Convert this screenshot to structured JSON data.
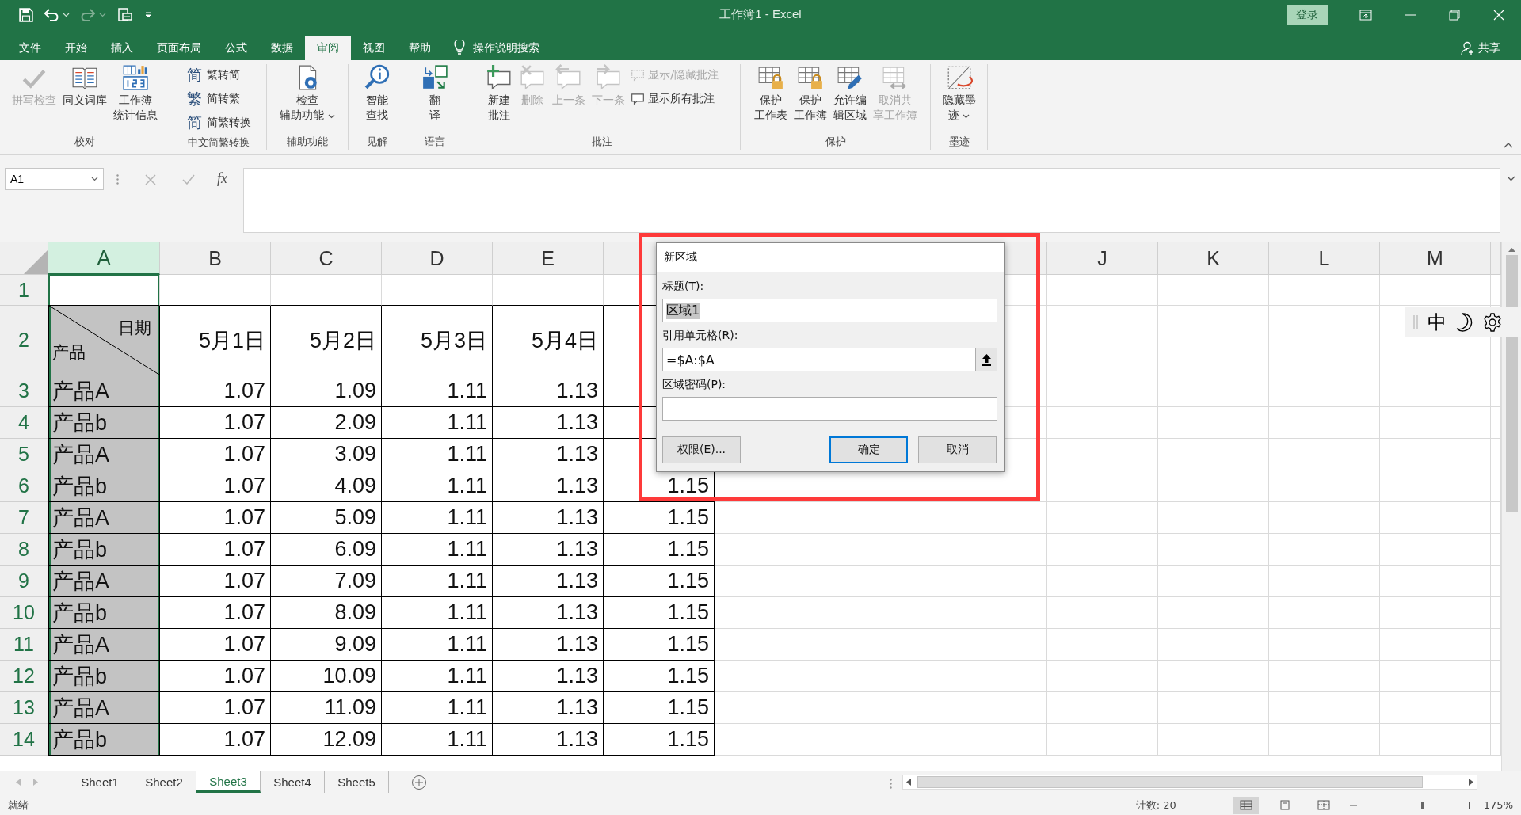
{
  "title_bar": {
    "title": "工作簿1 - Excel",
    "sign_in": "登录"
  },
  "ribbon_tabs": [
    {
      "label": "文件",
      "selected": false
    },
    {
      "label": "开始",
      "selected": false
    },
    {
      "label": "插入",
      "selected": false
    },
    {
      "label": "页面布局",
      "selected": false
    },
    {
      "label": "公式",
      "selected": false
    },
    {
      "label": "数据",
      "selected": false
    },
    {
      "label": "审阅",
      "selected": true
    },
    {
      "label": "视图",
      "selected": false
    },
    {
      "label": "帮助",
      "selected": false
    }
  ],
  "tell_me": "操作说明搜索",
  "share": "共享",
  "ribbon": {
    "groups": [
      {
        "label": "校对",
        "items": [
          {
            "kind": "large",
            "lines": [
              "拼写检查"
            ],
            "disabled": true,
            "dropdown": false
          },
          {
            "kind": "large",
            "lines": [
              "同义词库"
            ],
            "disabled": false,
            "dropdown": false
          },
          {
            "kind": "large",
            "lines": [
              "工作簿",
              "统计信息"
            ],
            "disabled": false,
            "dropdown": false
          }
        ]
      },
      {
        "label": "中文简繁转换",
        "items": [
          {
            "kind": "small",
            "glyph": "简",
            "label": "繁转简",
            "disabled": false,
            "dropdown": false
          },
          {
            "kind": "small",
            "glyph": "繁",
            "label": "简转繁",
            "disabled": false,
            "dropdown": false
          },
          {
            "kind": "small",
            "glyph": "简",
            "label": "简繁转换",
            "disabled": false,
            "dropdown": false
          }
        ]
      },
      {
        "label": "辅助功能",
        "items": [
          {
            "kind": "large",
            "lines": [
              "检查",
              "辅助功能"
            ],
            "disabled": false,
            "dropdown": true
          }
        ]
      },
      {
        "label": "见解",
        "items": [
          {
            "kind": "large",
            "lines": [
              "智能",
              "查找"
            ],
            "disabled": false,
            "dropdown": false
          }
        ]
      },
      {
        "label": "语言",
        "items": [
          {
            "kind": "large",
            "lines": [
              "翻",
              "译"
            ],
            "disabled": false,
            "dropdown": false
          }
        ]
      },
      {
        "label": "批注",
        "items": [
          {
            "kind": "large",
            "lines": [
              "新建",
              "批注"
            ],
            "disabled": false,
            "dropdown": false
          },
          {
            "kind": "large",
            "lines": [
              "删除"
            ],
            "disabled": true,
            "dropdown": false
          },
          {
            "kind": "large",
            "lines": [
              "上一条"
            ],
            "disabled": true,
            "dropdown": false
          },
          {
            "kind": "large",
            "lines": [
              "下一条"
            ],
            "disabled": true,
            "dropdown": false
          },
          {
            "kind": "small",
            "label": "显示/隐藏批注",
            "disabled": true,
            "dropdown": false
          },
          {
            "kind": "small",
            "label": "显示所有批注",
            "disabled": false,
            "dropdown": false
          }
        ]
      },
      {
        "label": "保护",
        "items": [
          {
            "kind": "large",
            "lines": [
              "保护",
              "工作表"
            ],
            "disabled": false,
            "dropdown": false
          },
          {
            "kind": "large",
            "lines": [
              "保护",
              "工作簿"
            ],
            "disabled": false,
            "dropdown": false
          },
          {
            "kind": "large",
            "lines": [
              "允许编",
              "辑区域"
            ],
            "disabled": false,
            "dropdown": false
          },
          {
            "kind": "large",
            "lines": [
              "取消共",
              "享工作簿"
            ],
            "disabled": true,
            "dropdown": false
          }
        ]
      },
      {
        "label": "墨迹",
        "items": [
          {
            "kind": "large",
            "lines": [
              "隐藏墨",
              "迹"
            ],
            "disabled": false,
            "dropdown": true
          }
        ]
      }
    ]
  },
  "formula_bar": {
    "name_box": "A1",
    "function_label": "fx"
  },
  "sheet": {
    "columns": [
      {
        "label": "A",
        "selected": true
      },
      {
        "label": "B",
        "selected": false
      },
      {
        "label": "C",
        "selected": false
      },
      {
        "label": "D",
        "selected": false
      },
      {
        "label": "E",
        "selected": false
      }
    ],
    "right_columns": [
      {
        "label": "J",
        "selected": false
      },
      {
        "label": "K",
        "selected": false
      },
      {
        "label": "L",
        "selected": false
      },
      {
        "label": "M",
        "selected": false
      }
    ],
    "rows": [
      {
        "number": "1",
        "kind": "blank",
        "selected": true
      },
      {
        "number": "2",
        "kind": "header",
        "selected": true,
        "corner": {
          "top": "日期",
          "bottom": "产品"
        },
        "cells": [
          "5月1日",
          "5月2日",
          "5月3日",
          "5月4日"
        ]
      },
      {
        "number": "3",
        "kind": "data",
        "selected": true,
        "cells": [
          "产品A",
          "1.07",
          "1.09",
          "1.11",
          "1.13"
        ]
      },
      {
        "number": "4",
        "kind": "data",
        "selected": true,
        "cells": [
          "产品b",
          "1.07",
          "2.09",
          "1.11",
          "1.13"
        ]
      },
      {
        "number": "5",
        "kind": "data",
        "selected": true,
        "cells": [
          "产品A",
          "1.07",
          "3.09",
          "1.11",
          "1.13"
        ]
      },
      {
        "number": "6",
        "kind": "data",
        "selected": true,
        "cells": [
          "产品b",
          "1.07",
          "4.09",
          "1.11",
          "1.13",
          "1.15"
        ]
      },
      {
        "number": "7",
        "kind": "data",
        "selected": true,
        "cells": [
          "产品A",
          "1.07",
          "5.09",
          "1.11",
          "1.13",
          "1.15"
        ]
      },
      {
        "number": "8",
        "kind": "data",
        "selected": true,
        "cells": [
          "产品b",
          "1.07",
          "6.09",
          "1.11",
          "1.13",
          "1.15"
        ]
      },
      {
        "number": "9",
        "kind": "data",
        "selected": true,
        "cells": [
          "产品A",
          "1.07",
          "7.09",
          "1.11",
          "1.13",
          "1.15"
        ]
      },
      {
        "number": "10",
        "kind": "data",
        "selected": true,
        "cells": [
          "产品b",
          "1.07",
          "8.09",
          "1.11",
          "1.13",
          "1.15"
        ]
      },
      {
        "number": "11",
        "kind": "data",
        "selected": true,
        "cells": [
          "产品A",
          "1.07",
          "9.09",
          "1.11",
          "1.13",
          "1.15"
        ]
      },
      {
        "number": "12",
        "kind": "data",
        "selected": true,
        "cells": [
          "产品b",
          "1.07",
          "10.09",
          "1.11",
          "1.13",
          "1.15"
        ]
      },
      {
        "number": "13",
        "kind": "data",
        "selected": true,
        "cells": [
          "产品A",
          "1.07",
          "11.09",
          "1.11",
          "1.13",
          "1.15"
        ]
      },
      {
        "number": "14",
        "kind": "data",
        "selected": true,
        "cells": [
          "产品b",
          "1.07",
          "12.09",
          "1.11",
          "1.13",
          "1.15"
        ]
      }
    ]
  },
  "dialog": {
    "title": "新区域",
    "fields": [
      {
        "kind": "text",
        "label": "标题(T):",
        "value": "区域1",
        "text_selected": true
      },
      {
        "kind": "reference",
        "label": "引用单元格(R):",
        "value": "=$A:$A"
      },
      {
        "kind": "password",
        "label": "区域密码(P):"
      }
    ],
    "buttons": [
      {
        "label": "权限(E)...",
        "default": false
      },
      {
        "label": "确定",
        "default": true
      },
      {
        "label": "取消",
        "default": false
      }
    ]
  },
  "sheet_tabs": [
    {
      "label": "Sheet1",
      "selected": false
    },
    {
      "label": "Sheet2",
      "selected": false
    },
    {
      "label": "Sheet3",
      "selected": true
    },
    {
      "label": "Sheet4",
      "selected": false
    },
    {
      "label": "Sheet5",
      "selected": false
    }
  ],
  "status_bar": {
    "status": "就绪",
    "count": "计数: 20",
    "views": [
      {
        "selected": true
      },
      {
        "selected": false
      },
      {
        "selected": false
      }
    ],
    "zoom": {
      "level": 0.62,
      "reading": "175%"
    }
  },
  "ime_toolbar": {
    "mode": "中"
  }
}
